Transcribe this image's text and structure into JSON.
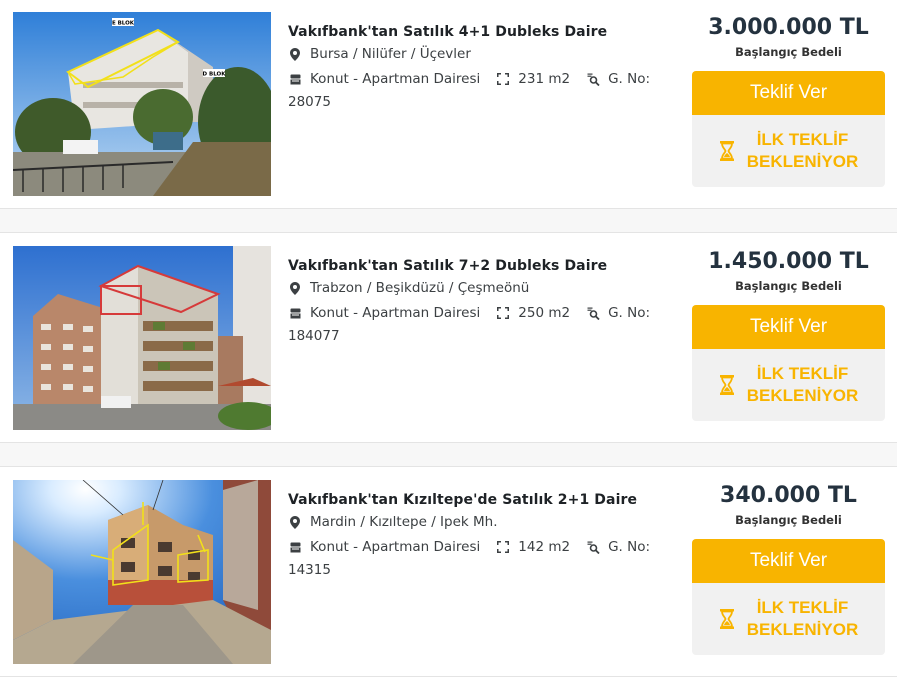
{
  "listings": [
    {
      "title": "Vakıfbank'tan Satılık 4+1 Dubleks Daire",
      "location": "Bursa / Nilüfer / Üçevler",
      "type": "Konut - Apartman Dairesi",
      "area": "231 m2",
      "gno_label": "G. No:",
      "gno_value": "28075",
      "price": "3.000.000 TL",
      "price_label": "Başlangıç Bedeli",
      "bid_button": "Teklif Ver",
      "status_line1": "İLK TEKLİF",
      "status_line2": "BEKLENİYOR",
      "photo_labels": [
        "E BLOK",
        "D BLOK"
      ]
    },
    {
      "title": "Vakıfbank'tan Satılık 7+2 Dubleks Daire",
      "location": "Trabzon / Beşikdüzü / Çeşmeönü",
      "type": "Konut - Apartman Dairesi",
      "area": "250 m2",
      "gno_label": "G. No:",
      "gno_value": "184077",
      "price": "1.450.000 TL",
      "price_label": "Başlangıç Bedeli",
      "bid_button": "Teklif Ver",
      "status_line1": "İLK TEKLİF",
      "status_line2": "BEKLENİYOR"
    },
    {
      "title": "Vakıfbank'tan Kızıltepe'de Satılık 2+1 Daire",
      "location": "Mardin / Kızıltepe / Ipek Mh.",
      "type": "Konut - Apartman Dairesi",
      "area": "142 m2",
      "gno_label": "G. No:",
      "gno_value": "14315",
      "price": "340.000 TL",
      "price_label": "Başlangıç Bedeli",
      "bid_button": "Teklif Ver",
      "status_line1": "İLK TEKLİF",
      "status_line2": "BEKLENİYOR"
    }
  ],
  "colors": {
    "accent": "#f8b400",
    "status_bg": "#f1f1f1",
    "price_text": "#24323f",
    "title_text": "#1e2226"
  },
  "icons": {
    "location": "map-pin-icon",
    "type": "building-icon",
    "area": "area-expand-icon",
    "gno": "search-document-icon",
    "status": "hourglass-icon"
  }
}
